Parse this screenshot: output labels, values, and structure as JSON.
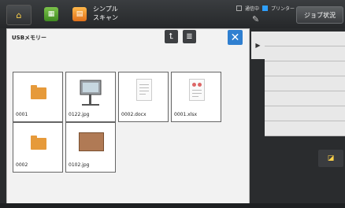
{
  "topbar": {
    "simple_scan_label": "シンプル\nスキャン",
    "status_1": "通信中",
    "status_2": "プリンター",
    "job_status_label": "ジョブ状況"
  },
  "panel": {
    "title": "USBメモリー",
    "files": [
      {
        "name": "0001",
        "type": "folder"
      },
      {
        "name": "0122.jpg",
        "type": "image-board"
      },
      {
        "name": "0002.docx",
        "type": "document"
      },
      {
        "name": "0001.xlsx",
        "type": "document"
      },
      {
        "name": "0002",
        "type": "folder"
      },
      {
        "name": "0102.jpg",
        "type": "image-book"
      }
    ]
  },
  "icons": {
    "home": "home-icon",
    "up": "up-arrow-icon",
    "list": "list-view-icon",
    "close": "close-icon",
    "expand": "expand-arrow-icon",
    "wrench": "wrench-icon",
    "reset": "reset-icon"
  },
  "colors": {
    "accent_blue": "#2f7fd0",
    "folder_orange": "#e69a3a",
    "status_on": "#2ea0ff"
  }
}
